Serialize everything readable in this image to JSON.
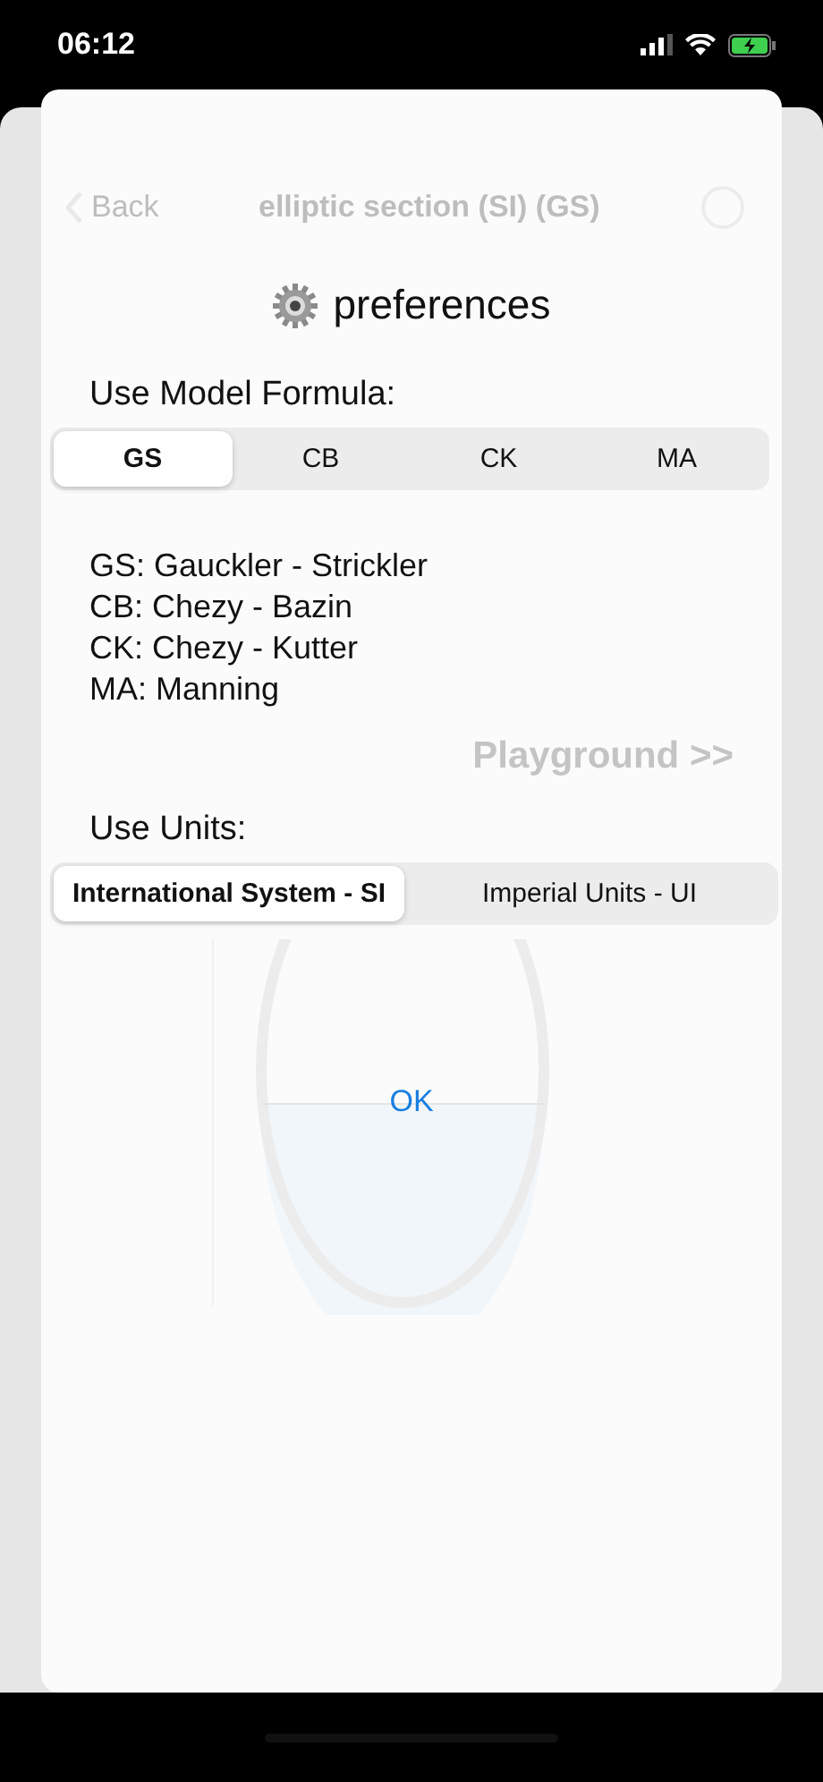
{
  "status_bar": {
    "time": "06:12"
  },
  "background": {
    "back": "Back",
    "title": "elliptic section (SI) (GS)",
    "playground": "Playground >>"
  },
  "dialog": {
    "title": "preferences",
    "formula_label": "Use Model Formula:",
    "formulas": [
      {
        "label": "GS",
        "selected": true
      },
      {
        "label": "CB",
        "selected": false
      },
      {
        "label": "CK",
        "selected": false
      },
      {
        "label": "MA",
        "selected": false
      }
    ],
    "legend": [
      "GS: Gauckler - Strickler",
      "CB: Chezy - Bazin",
      "CK: Chezy - Kutter",
      "MA: Manning"
    ],
    "units_label": "Use Units:",
    "units": [
      {
        "label": "International System - SI",
        "selected": true
      },
      {
        "label": "Imperial Units - UI",
        "selected": false
      }
    ],
    "ok": "OK"
  }
}
